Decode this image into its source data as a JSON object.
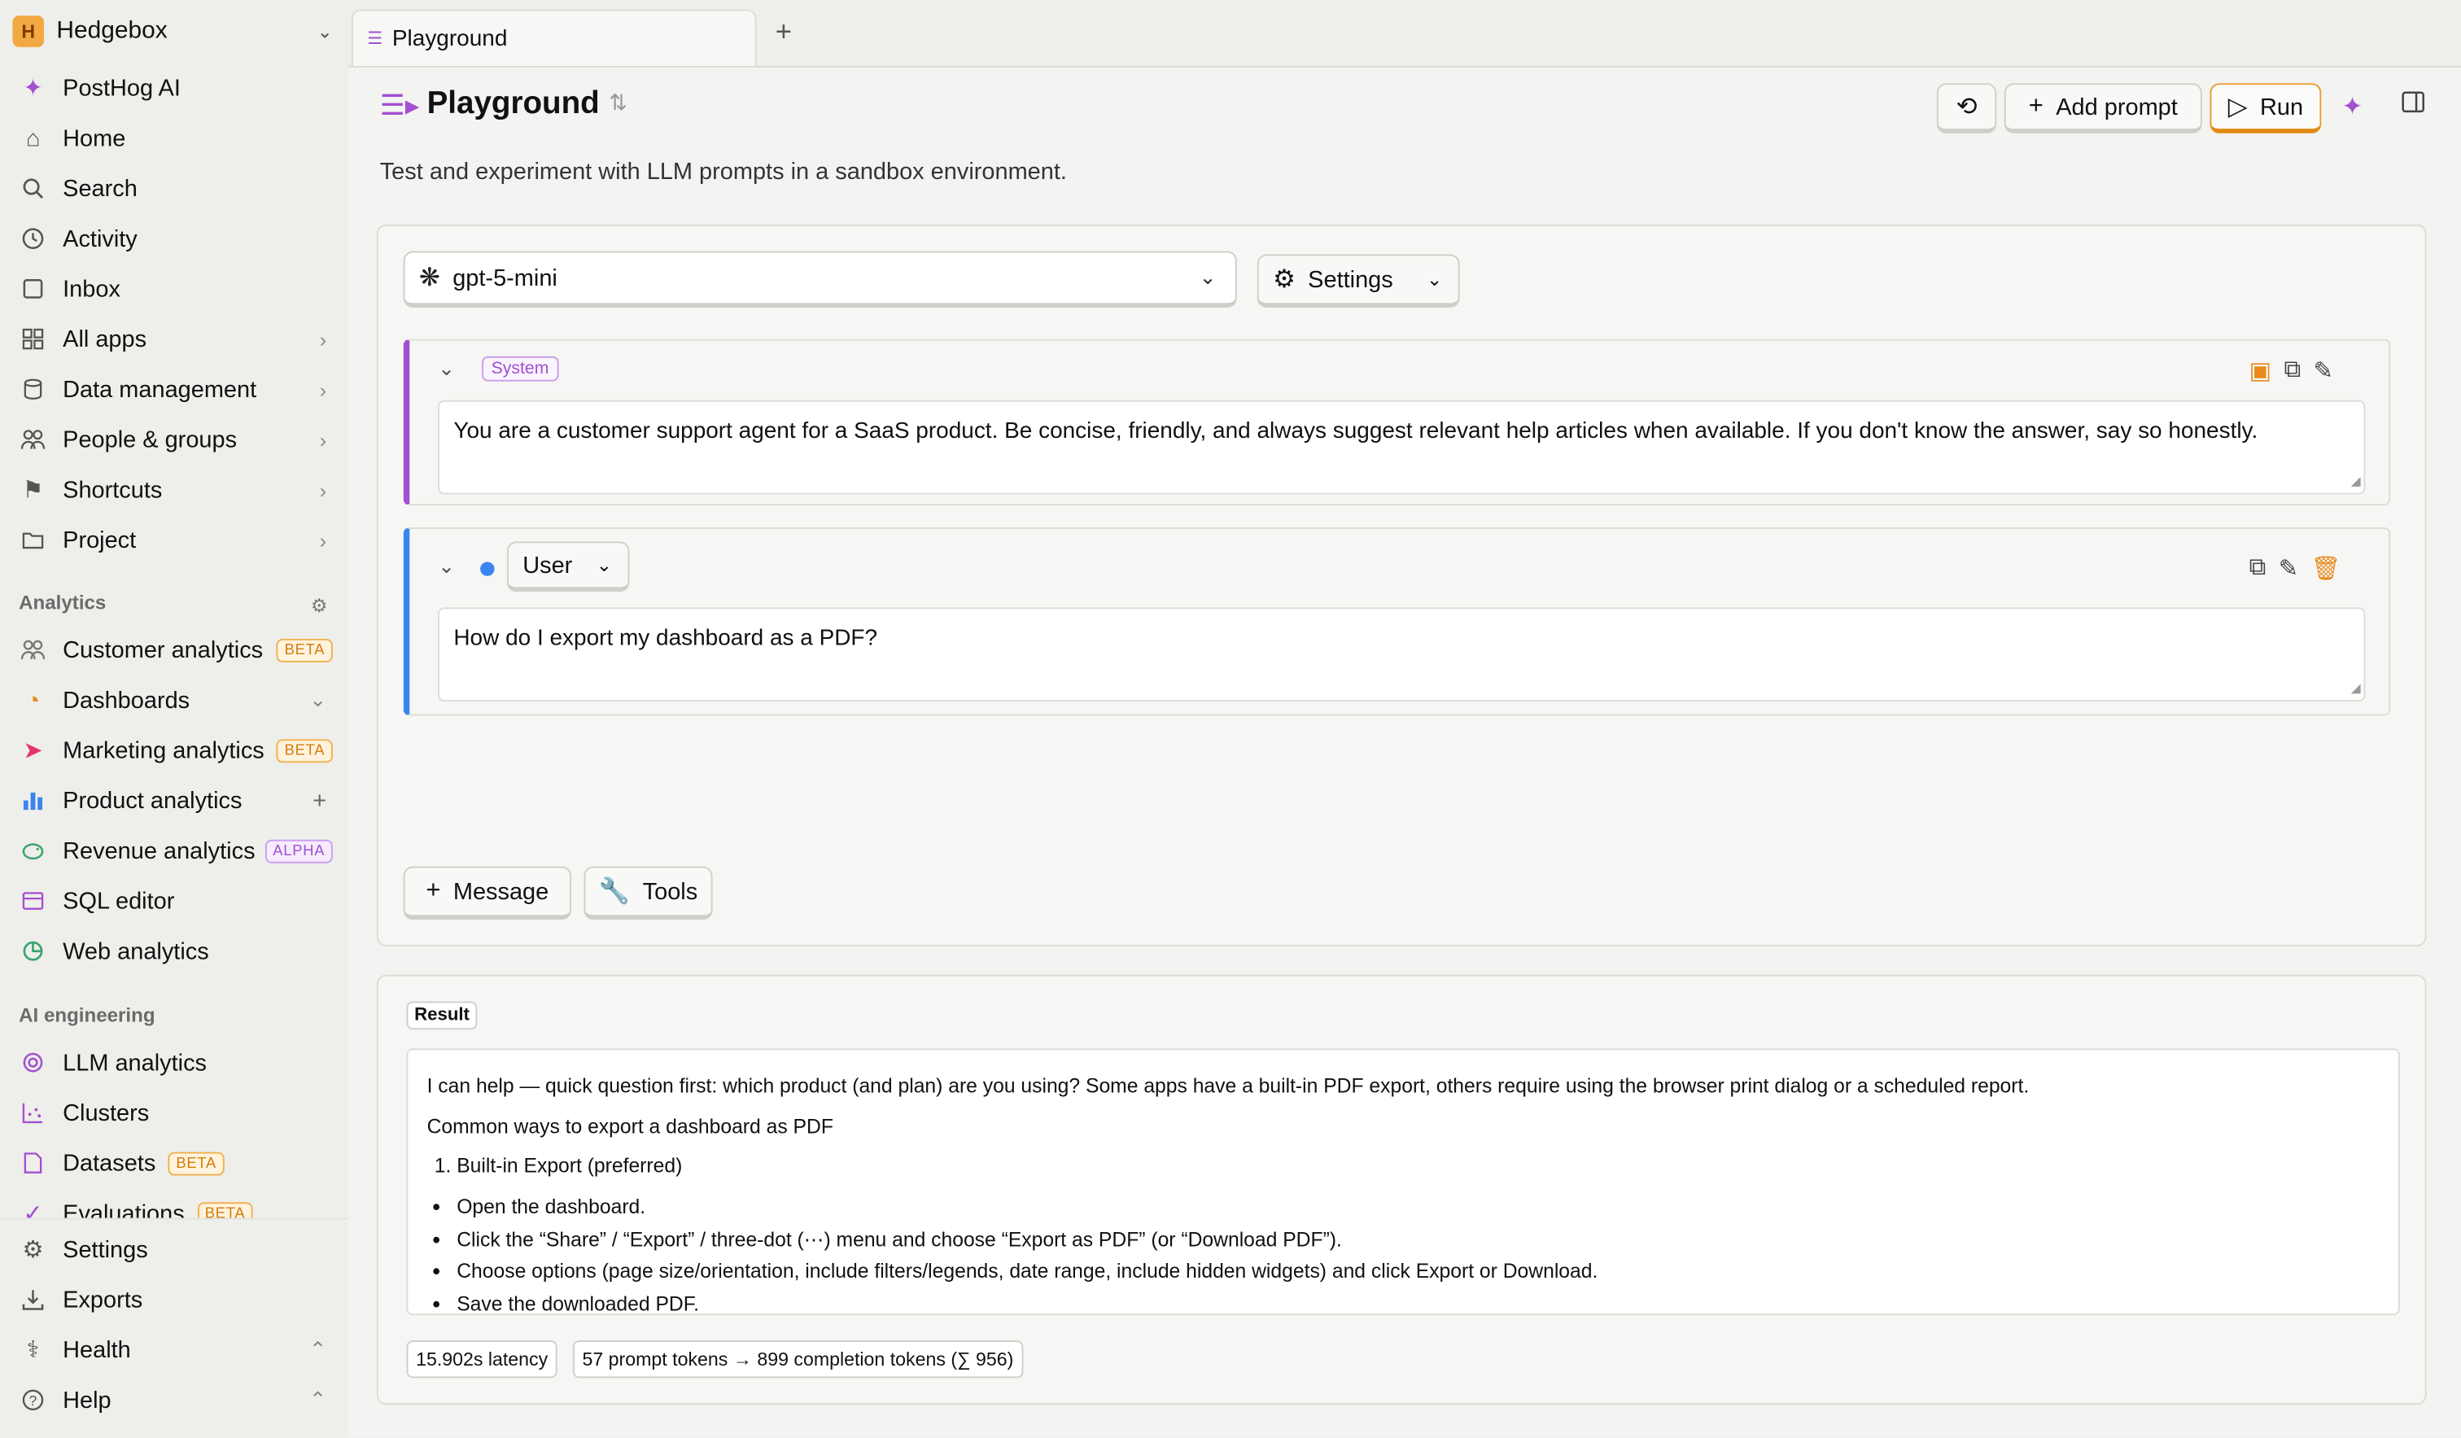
{
  "sidebar": {
    "workspace": {
      "initial": "H",
      "name": "Hedgebox"
    },
    "top_items": [
      {
        "label": "PostHog AI",
        "icon": "sparkle-icon"
      },
      {
        "label": "Home",
        "icon": "home-icon"
      },
      {
        "label": "Search",
        "icon": "search-icon"
      },
      {
        "label": "Activity",
        "icon": "clock-icon"
      },
      {
        "label": "Inbox",
        "icon": "inbox-icon"
      },
      {
        "label": "All apps",
        "icon": "grid-icon"
      },
      {
        "label": "Data management",
        "icon": "database-icon"
      },
      {
        "label": "People & groups",
        "icon": "people-icon"
      },
      {
        "label": "Shortcuts",
        "icon": "pin-icon"
      },
      {
        "label": "Project",
        "icon": "folder-icon"
      }
    ],
    "analytics_title": "Analytics",
    "analytics_items": [
      {
        "label": "Customer analytics",
        "badge": "BETA",
        "icon": "people-icon"
      },
      {
        "label": "Dashboards",
        "icon": "gauge-icon"
      },
      {
        "label": "Marketing analytics",
        "badge": "BETA",
        "icon": "megaphone-icon"
      },
      {
        "label": "Product analytics",
        "icon": "bar-chart-icon"
      },
      {
        "label": "Revenue analytics",
        "badge": "ALPHA",
        "icon": "piggy-bank-icon"
      },
      {
        "label": "SQL editor",
        "icon": "sql-icon"
      },
      {
        "label": "Web analytics",
        "icon": "pie-icon"
      }
    ],
    "ai_title": "AI engineering",
    "ai_items": [
      {
        "label": "LLM analytics",
        "icon": "target-icon"
      },
      {
        "label": "Clusters",
        "icon": "scatter-icon"
      },
      {
        "label": "Datasets",
        "badge": "BETA",
        "icon": "document-icon"
      },
      {
        "label": "Evaluations",
        "badge": "BETA",
        "icon": "check-icon"
      }
    ],
    "bottom_items": [
      {
        "label": "Settings",
        "icon": "gear-icon"
      },
      {
        "label": "Exports",
        "icon": "download-icon"
      },
      {
        "label": "Health",
        "icon": "stethoscope-icon"
      },
      {
        "label": "Help",
        "icon": "help-icon"
      }
    ]
  },
  "tab": {
    "label": "Playground"
  },
  "header": {
    "title": "Playground",
    "subtitle": "Test and experiment with LLM prompts in a sandbox environment.",
    "add_prompt_label": "Add prompt",
    "run_label": "Run"
  },
  "editor": {
    "model": "gpt-5-mini",
    "settings_label": "Settings",
    "system": {
      "role": "System",
      "text": "You are a customer support agent for a SaaS product. Be concise, friendly, and always suggest relevant help articles when available. If you don't know the answer, say so honestly."
    },
    "user": {
      "role": "User",
      "text": "How do I export my dashboard as a PDF?"
    },
    "message_label": "Message",
    "tools_label": "Tools"
  },
  "result": {
    "tag": "Result",
    "intro": "I can help — quick question first: which product (and plan) are you using? Some apps have a built-in PDF export, others require using the browser print dialog or a scheduled report.",
    "heading": "Common ways to export a dashboard as PDF",
    "ordered": [
      "Built-in Export (preferred)"
    ],
    "bullets": [
      "Open the dashboard.",
      "Click the “Share” / “Export” / three-dot (⋯) menu and choose “Export as PDF” (or “Download PDF”).",
      "Choose options (page size/orientation, include filters/legends, date range, include hidden widgets) and click Export or Download.",
      "Save the downloaded PDF."
    ],
    "latency": "15.902s latency",
    "tokens": "57 prompt tokens → 899 completion tokens (∑ 956)"
  },
  "colors": {
    "accent_purple": "#a24fd0",
    "accent_orange": "#e99a2a",
    "user_blue": "#3a84f0",
    "workspace_badge": "#f3a941"
  }
}
